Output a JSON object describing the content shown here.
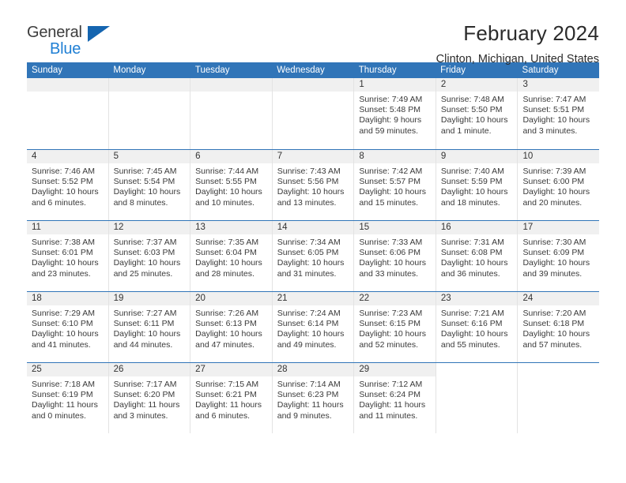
{
  "brand": {
    "name_top": "General",
    "name_bottom": "Blue",
    "triangle_color": "#1565b0",
    "blue_text_color": "#1f7fd4"
  },
  "header": {
    "title": "February 2024",
    "location": "Clinton, Michigan, United States"
  },
  "theme": {
    "header_bar": "#3175b8",
    "day_band": "#f0f0f0",
    "row_rule": "#3175b8",
    "cell_divider": "#e3e3e3",
    "text": "#3a3a3a"
  },
  "weekday_headers": [
    "Sunday",
    "Monday",
    "Tuesday",
    "Wednesday",
    "Thursday",
    "Friday",
    "Saturday"
  ],
  "labels": {
    "sunrise_prefix": "Sunrise:",
    "sunset_prefix": "Sunset:",
    "daylight_prefix": "Daylight:"
  },
  "weeks": [
    [
      {
        "day": "",
        "blank": true,
        "tail": false,
        "sunrise": "",
        "sunset": "",
        "daylight_line1": "",
        "daylight_line2": ""
      },
      {
        "day": "",
        "blank": true,
        "tail": false,
        "sunrise": "",
        "sunset": "",
        "daylight_line1": "",
        "daylight_line2": ""
      },
      {
        "day": "",
        "blank": true,
        "tail": false,
        "sunrise": "",
        "sunset": "",
        "daylight_line1": "",
        "daylight_line2": ""
      },
      {
        "day": "",
        "blank": true,
        "tail": false,
        "sunrise": "",
        "sunset": "",
        "daylight_line1": "",
        "daylight_line2": ""
      },
      {
        "day": "1",
        "blank": false,
        "tail": false,
        "sunrise": "Sunrise: 7:49 AM",
        "sunset": "Sunset: 5:48 PM",
        "daylight_line1": "Daylight: 9 hours",
        "daylight_line2": "and 59 minutes."
      },
      {
        "day": "2",
        "blank": false,
        "tail": false,
        "sunrise": "Sunrise: 7:48 AM",
        "sunset": "Sunset: 5:50 PM",
        "daylight_line1": "Daylight: 10 hours",
        "daylight_line2": "and 1 minute."
      },
      {
        "day": "3",
        "blank": false,
        "tail": false,
        "sunrise": "Sunrise: 7:47 AM",
        "sunset": "Sunset: 5:51 PM",
        "daylight_line1": "Daylight: 10 hours",
        "daylight_line2": "and 3 minutes."
      }
    ],
    [
      {
        "day": "4",
        "blank": false,
        "tail": false,
        "sunrise": "Sunrise: 7:46 AM",
        "sunset": "Sunset: 5:52 PM",
        "daylight_line1": "Daylight: 10 hours",
        "daylight_line2": "and 6 minutes."
      },
      {
        "day": "5",
        "blank": false,
        "tail": false,
        "sunrise": "Sunrise: 7:45 AM",
        "sunset": "Sunset: 5:54 PM",
        "daylight_line1": "Daylight: 10 hours",
        "daylight_line2": "and 8 minutes."
      },
      {
        "day": "6",
        "blank": false,
        "tail": false,
        "sunrise": "Sunrise: 7:44 AM",
        "sunset": "Sunset: 5:55 PM",
        "daylight_line1": "Daylight: 10 hours",
        "daylight_line2": "and 10 minutes."
      },
      {
        "day": "7",
        "blank": false,
        "tail": false,
        "sunrise": "Sunrise: 7:43 AM",
        "sunset": "Sunset: 5:56 PM",
        "daylight_line1": "Daylight: 10 hours",
        "daylight_line2": "and 13 minutes."
      },
      {
        "day": "8",
        "blank": false,
        "tail": false,
        "sunrise": "Sunrise: 7:42 AM",
        "sunset": "Sunset: 5:57 PM",
        "daylight_line1": "Daylight: 10 hours",
        "daylight_line2": "and 15 minutes."
      },
      {
        "day": "9",
        "blank": false,
        "tail": false,
        "sunrise": "Sunrise: 7:40 AM",
        "sunset": "Sunset: 5:59 PM",
        "daylight_line1": "Daylight: 10 hours",
        "daylight_line2": "and 18 minutes."
      },
      {
        "day": "10",
        "blank": false,
        "tail": false,
        "sunrise": "Sunrise: 7:39 AM",
        "sunset": "Sunset: 6:00 PM",
        "daylight_line1": "Daylight: 10 hours",
        "daylight_line2": "and 20 minutes."
      }
    ],
    [
      {
        "day": "11",
        "blank": false,
        "tail": false,
        "sunrise": "Sunrise: 7:38 AM",
        "sunset": "Sunset: 6:01 PM",
        "daylight_line1": "Daylight: 10 hours",
        "daylight_line2": "and 23 minutes."
      },
      {
        "day": "12",
        "blank": false,
        "tail": false,
        "sunrise": "Sunrise: 7:37 AM",
        "sunset": "Sunset: 6:03 PM",
        "daylight_line1": "Daylight: 10 hours",
        "daylight_line2": "and 25 minutes."
      },
      {
        "day": "13",
        "blank": false,
        "tail": false,
        "sunrise": "Sunrise: 7:35 AM",
        "sunset": "Sunset: 6:04 PM",
        "daylight_line1": "Daylight: 10 hours",
        "daylight_line2": "and 28 minutes."
      },
      {
        "day": "14",
        "blank": false,
        "tail": false,
        "sunrise": "Sunrise: 7:34 AM",
        "sunset": "Sunset: 6:05 PM",
        "daylight_line1": "Daylight: 10 hours",
        "daylight_line2": "and 31 minutes."
      },
      {
        "day": "15",
        "blank": false,
        "tail": false,
        "sunrise": "Sunrise: 7:33 AM",
        "sunset": "Sunset: 6:06 PM",
        "daylight_line1": "Daylight: 10 hours",
        "daylight_line2": "and 33 minutes."
      },
      {
        "day": "16",
        "blank": false,
        "tail": false,
        "sunrise": "Sunrise: 7:31 AM",
        "sunset": "Sunset: 6:08 PM",
        "daylight_line1": "Daylight: 10 hours",
        "daylight_line2": "and 36 minutes."
      },
      {
        "day": "17",
        "blank": false,
        "tail": false,
        "sunrise": "Sunrise: 7:30 AM",
        "sunset": "Sunset: 6:09 PM",
        "daylight_line1": "Daylight: 10 hours",
        "daylight_line2": "and 39 minutes."
      }
    ],
    [
      {
        "day": "18",
        "blank": false,
        "tail": false,
        "sunrise": "Sunrise: 7:29 AM",
        "sunset": "Sunset: 6:10 PM",
        "daylight_line1": "Daylight: 10 hours",
        "daylight_line2": "and 41 minutes."
      },
      {
        "day": "19",
        "blank": false,
        "tail": false,
        "sunrise": "Sunrise: 7:27 AM",
        "sunset": "Sunset: 6:11 PM",
        "daylight_line1": "Daylight: 10 hours",
        "daylight_line2": "and 44 minutes."
      },
      {
        "day": "20",
        "blank": false,
        "tail": false,
        "sunrise": "Sunrise: 7:26 AM",
        "sunset": "Sunset: 6:13 PM",
        "daylight_line1": "Daylight: 10 hours",
        "daylight_line2": "and 47 minutes."
      },
      {
        "day": "21",
        "blank": false,
        "tail": false,
        "sunrise": "Sunrise: 7:24 AM",
        "sunset": "Sunset: 6:14 PM",
        "daylight_line1": "Daylight: 10 hours",
        "daylight_line2": "and 49 minutes."
      },
      {
        "day": "22",
        "blank": false,
        "tail": false,
        "sunrise": "Sunrise: 7:23 AM",
        "sunset": "Sunset: 6:15 PM",
        "daylight_line1": "Daylight: 10 hours",
        "daylight_line2": "and 52 minutes."
      },
      {
        "day": "23",
        "blank": false,
        "tail": false,
        "sunrise": "Sunrise: 7:21 AM",
        "sunset": "Sunset: 6:16 PM",
        "daylight_line1": "Daylight: 10 hours",
        "daylight_line2": "and 55 minutes."
      },
      {
        "day": "24",
        "blank": false,
        "tail": false,
        "sunrise": "Sunrise: 7:20 AM",
        "sunset": "Sunset: 6:18 PM",
        "daylight_line1": "Daylight: 10 hours",
        "daylight_line2": "and 57 minutes."
      }
    ],
    [
      {
        "day": "25",
        "blank": false,
        "tail": false,
        "sunrise": "Sunrise: 7:18 AM",
        "sunset": "Sunset: 6:19 PM",
        "daylight_line1": "Daylight: 11 hours",
        "daylight_line2": "and 0 minutes."
      },
      {
        "day": "26",
        "blank": false,
        "tail": false,
        "sunrise": "Sunrise: 7:17 AM",
        "sunset": "Sunset: 6:20 PM",
        "daylight_line1": "Daylight: 11 hours",
        "daylight_line2": "and 3 minutes."
      },
      {
        "day": "27",
        "blank": false,
        "tail": false,
        "sunrise": "Sunrise: 7:15 AM",
        "sunset": "Sunset: 6:21 PM",
        "daylight_line1": "Daylight: 11 hours",
        "daylight_line2": "and 6 minutes."
      },
      {
        "day": "28",
        "blank": false,
        "tail": false,
        "sunrise": "Sunrise: 7:14 AM",
        "sunset": "Sunset: 6:23 PM",
        "daylight_line1": "Daylight: 11 hours",
        "daylight_line2": "and 9 minutes."
      },
      {
        "day": "29",
        "blank": false,
        "tail": false,
        "sunrise": "Sunrise: 7:12 AM",
        "sunset": "Sunset: 6:24 PM",
        "daylight_line1": "Daylight: 11 hours",
        "daylight_line2": "and 11 minutes."
      },
      {
        "day": "",
        "blank": true,
        "tail": true,
        "sunrise": "",
        "sunset": "",
        "daylight_line1": "",
        "daylight_line2": ""
      },
      {
        "day": "",
        "blank": true,
        "tail": true,
        "sunrise": "",
        "sunset": "",
        "daylight_line1": "",
        "daylight_line2": ""
      }
    ]
  ]
}
